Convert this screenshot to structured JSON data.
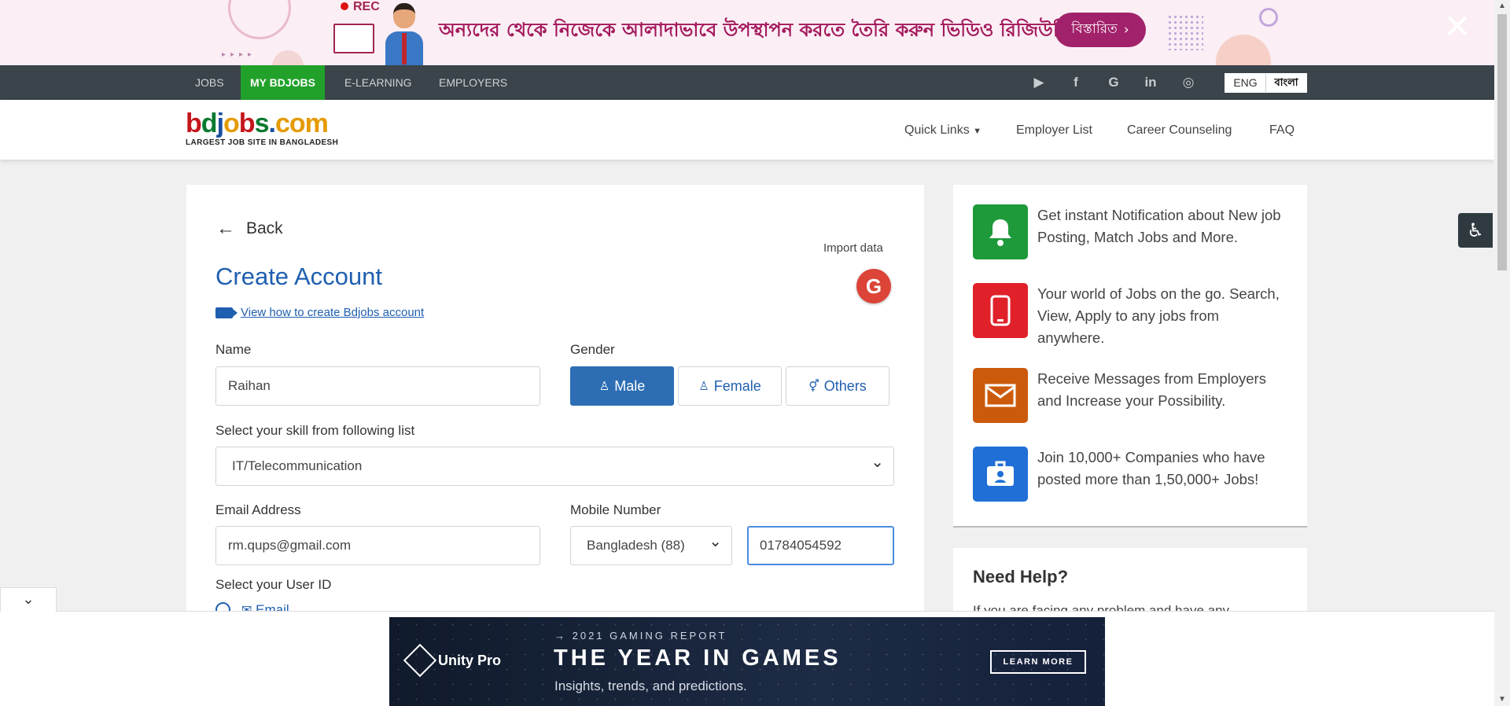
{
  "promo": {
    "rec": "REC",
    "headline": "অন্যদের থেকে নিজেকে আলাদাভাবে উপস্থাপন করতে তৈরি করুন ভিডিও রিজিউমি।",
    "cta": "বিস্তারিত"
  },
  "topnav": {
    "items": [
      "JOBS",
      "MY BDJOBS",
      "E-LEARNING",
      "EMPLOYERS"
    ],
    "lang_eng": "ENG",
    "lang_bn": "বাংলা"
  },
  "header": {
    "logo_text": "bdjobs.com",
    "logo_tag": "LARGEST JOB SITE IN BANGLADESH",
    "links": [
      "Quick Links",
      "Employer List",
      "Career Counseling",
      "FAQ"
    ]
  },
  "form": {
    "back": "Back",
    "import_data": "Import data",
    "title": "Create Account",
    "howto": "View how to create Bdjobs account",
    "name_label": "Name",
    "name_value": "Raihan",
    "gender_label": "Gender",
    "gender_options": [
      "Male",
      "Female",
      "Others"
    ],
    "gender_selected": "Male",
    "skill_label": "Select your skill from following list",
    "skill_value": "IT/Telecommunication",
    "email_label": "Email Address",
    "email_value": "rm.qups@gmail.com",
    "mobile_label": "Mobile Number",
    "country_value": "Bangladesh (88)",
    "mobile_value": "01784054592",
    "userid_label": "Select your User ID",
    "userid_option": "Email"
  },
  "side": {
    "features": [
      {
        "text": "Get instant Notification about New job Posting, Match Jobs and More.",
        "color": "#1e9a3a",
        "icon": "bell-icon"
      },
      {
        "text": "Your world of Jobs on the go. Search, View, Apply to any jobs from anywhere.",
        "color": "#e0212a",
        "icon": "mobile-icon"
      },
      {
        "text": "Receive Messages from Employers and Increase your Possibility.",
        "color": "#cc5a0c",
        "icon": "mail-icon"
      },
      {
        "text": "Join 10,000+ Companies who have posted more than 1,50,000+ Jobs!",
        "color": "#1f6fd6",
        "icon": "id-badge-icon"
      }
    ],
    "help_title": "Need Help?",
    "help_text": "If you are facing any problem and have any"
  },
  "ad": {
    "brand": "Unity Pro",
    "kicker": "→ 2021 GAMING REPORT",
    "headline": "THE YEAR IN GAMES",
    "sub": "Insights, trends, and predictions.",
    "cta": "LEARN MORE"
  }
}
